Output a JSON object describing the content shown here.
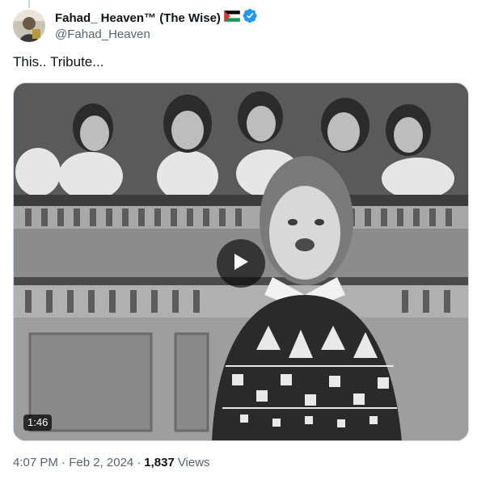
{
  "author": {
    "display_name": "Fahad_ Heaven™ (The Wise)",
    "handle": "@Fahad_Heaven",
    "flag_icon": "palestine-flag-icon",
    "verified_icon": "verified-badge-icon",
    "verified_color": "#1d9bf0"
  },
  "tweet": {
    "text": "This.. Tribute..."
  },
  "media": {
    "type": "video",
    "duration": "1:46",
    "play_icon": "play-icon"
  },
  "meta": {
    "timestamp": "4:07 PM · Feb 2, 2024",
    "separator": "·",
    "views_count": "1,837",
    "views_label": "Views"
  },
  "colors": {
    "text_primary": "#0f1419",
    "text_secondary": "#536471",
    "border": "#cfd9de"
  }
}
